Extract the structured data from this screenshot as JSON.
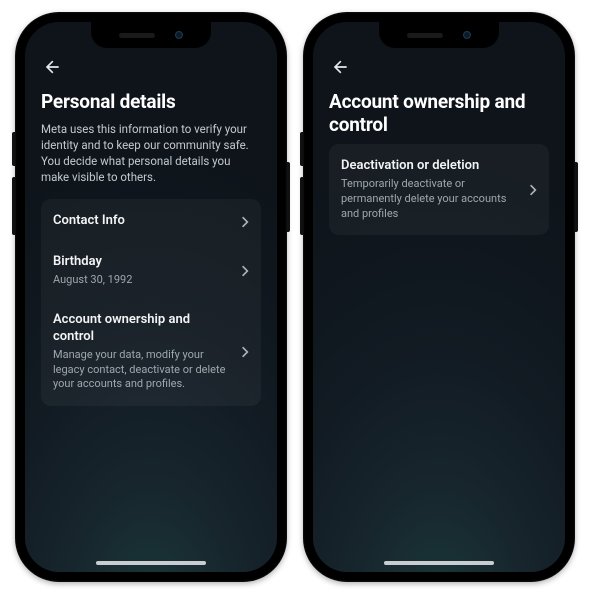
{
  "left": {
    "title": "Personal details",
    "subtitle": "Meta uses this information to verify your identity and to keep our community safe. You decide what personal details you make visible to others.",
    "rows": [
      {
        "title": "Contact Info"
      },
      {
        "title": "Birthday",
        "sub": "August 30, 1992"
      },
      {
        "title": "Account ownership and control",
        "sub": "Manage your data, modify your legacy contact, deactivate or delete your accounts and profiles."
      }
    ]
  },
  "right": {
    "title": "Account ownership and control",
    "rows": [
      {
        "title": "Deactivation or deletion",
        "sub": "Temporarily deactivate or permanently delete your accounts and profiles"
      }
    ]
  }
}
